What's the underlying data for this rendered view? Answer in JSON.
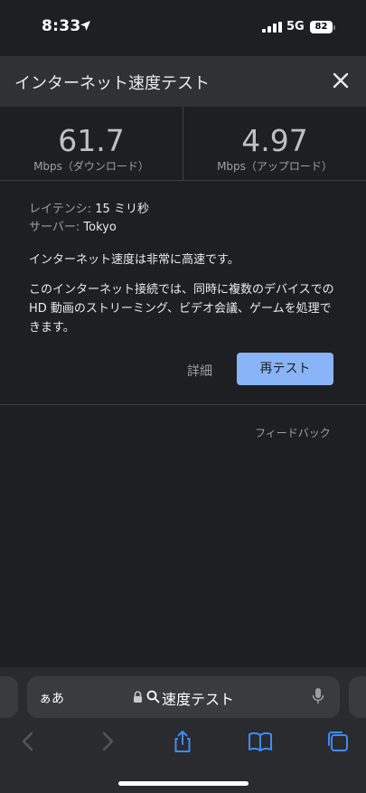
{
  "status_bar": {
    "time": "8:33",
    "network": "5G",
    "battery": "82"
  },
  "header": {
    "title": "インターネット速度テスト"
  },
  "results": {
    "download": {
      "value": "61.7",
      "unit": "Mbps（ダウンロード）"
    },
    "upload": {
      "value": "4.97",
      "unit": "Mbps（アップロード）"
    }
  },
  "info": {
    "latency_label": "レイテンシ:",
    "latency_value": "15 ミリ秒",
    "server_label": "サーバー:",
    "server_value": "Tokyo",
    "status": "インターネット速度は非常に高速です。",
    "description": "このインターネット接続では、同時に複数のデバイスでの HD 動画のストリーミング、ビデオ会議、ゲームを処理できます。"
  },
  "actions": {
    "details": "詳細",
    "retest": "再テスト"
  },
  "feedback": "フィードバック",
  "browser": {
    "text_size": "ぁあ",
    "address": "速度テスト"
  },
  "colors": {
    "accent": "#8ab4f8",
    "background": "#1e1f22",
    "header_bg": "#303134"
  }
}
